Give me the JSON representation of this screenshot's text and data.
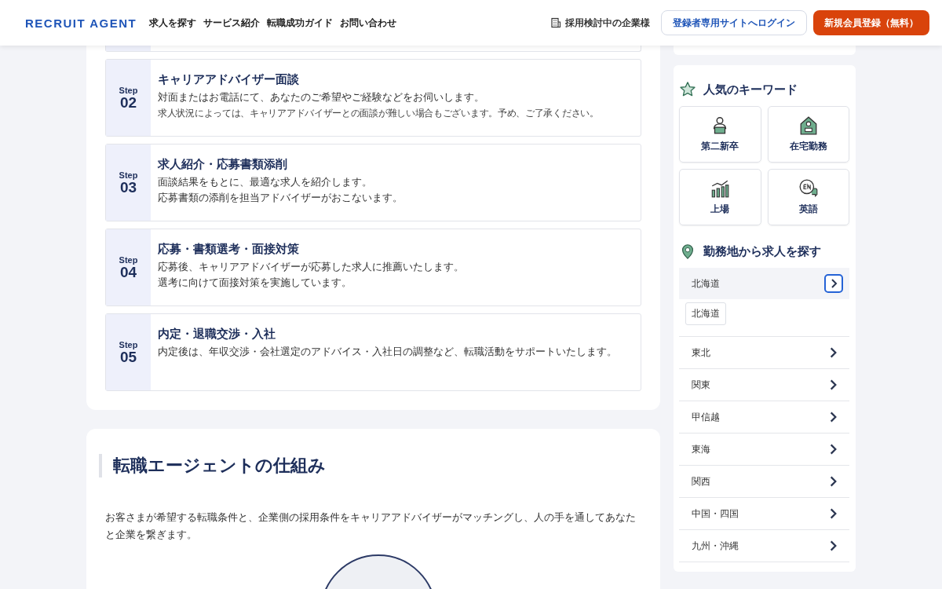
{
  "header": {
    "logo": "RECRUIT AGENT",
    "nav": [
      "求人を探す",
      "サービス紹介",
      "転職成功ガイド",
      "お問い合わせ"
    ],
    "company_link": "採用検討中の企業様",
    "login_button": "登録者専用サイトへログイン",
    "register_button": "新規会員登録（無料）"
  },
  "steps": [
    {
      "label": "Step",
      "number": "02",
      "title": "キャリアアドバイザー面談",
      "lines": [
        {
          "kind": "body",
          "text": "対面またはお電話にて、あなたのご希望やご経験などをお伺いします。"
        },
        {
          "kind": "note",
          "text": "求人状況によっては、キャリアアドバイザーとの面談が難しい場合もございます。予め、ご了承ください。"
        }
      ]
    },
    {
      "label": "Step",
      "number": "03",
      "title": "求人紹介・応募書類添削",
      "lines": [
        {
          "kind": "body",
          "text": "面談結果をもとに、最適な求人を紹介します。"
        },
        {
          "kind": "body",
          "text": "応募書類の添削を担当アドバイザーがおこないます。"
        }
      ]
    },
    {
      "label": "Step",
      "number": "04",
      "title": "応募・書類選考・面接対策",
      "lines": [
        {
          "kind": "body",
          "text": "応募後、キャリアアドバイザーが応募した求人に推薦いたします。"
        },
        {
          "kind": "body",
          "text": "選考に向けて面接対策を実施しています。"
        }
      ]
    },
    {
      "label": "Step",
      "number": "05",
      "title": "内定・退職交渉・入社",
      "lines": [
        {
          "kind": "body",
          "text": "内定後は、年収交渉・会社選定のアドバイス・入社日の調整など、転職活動をサポートいたします。"
        }
      ]
    }
  ],
  "mechanism": {
    "title": "転職エージェントの仕組み",
    "description": "お客さまが希望する転職条件と、企業側の採用条件をキャリアアドバイザーがマッチングし、人の手を通してあなたと企業を繋ぎます。"
  },
  "sidebar": {
    "keywords_title": "人気のキーワード",
    "keywords": [
      {
        "kind": "graduate",
        "label": "第二新卒"
      },
      {
        "kind": "remote",
        "label": "在宅勤務"
      },
      {
        "kind": "listed",
        "label": "上場"
      },
      {
        "kind": "english",
        "label": "英語"
      }
    ],
    "regions_title": "勤務地から求人を探す",
    "regions": [
      {
        "name": "北海道",
        "expanded": true,
        "prefectures": [
          "北海道"
        ]
      },
      {
        "name": "東北",
        "expanded": false
      },
      {
        "name": "関東",
        "expanded": false
      },
      {
        "name": "甲信越",
        "expanded": false
      },
      {
        "name": "東海",
        "expanded": false
      },
      {
        "name": "関西",
        "expanded": false
      },
      {
        "name": "中国・四国",
        "expanded": false
      },
      {
        "name": "九州・沖縄",
        "expanded": false
      }
    ]
  }
}
